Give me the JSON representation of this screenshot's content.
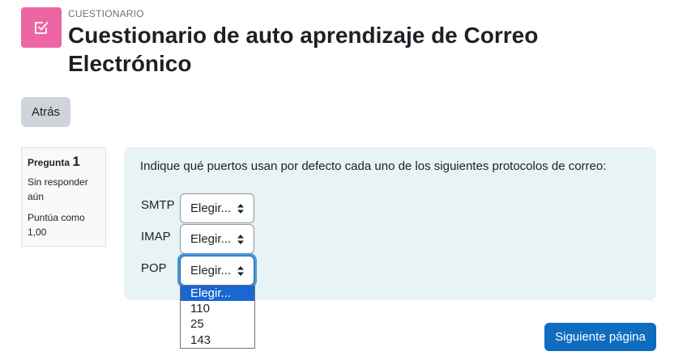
{
  "header": {
    "activity_icon": "quiz-checkbox-icon",
    "activity_type": "CUESTIONARIO",
    "title": "Cuestionario de auto aprendizaje de Correo Electrónico"
  },
  "nav": {
    "back_label": "Atrás"
  },
  "question_info": {
    "label": "Pregunta",
    "number": "1",
    "state": "Sin responder aún",
    "grade": "Puntúa como 1,00"
  },
  "question": {
    "text": "Indique qué puertos usan por defecto cada uno de los siguientes protocolos de correo:",
    "rows": [
      {
        "label": "SMTP",
        "selected": "Elegir..."
      },
      {
        "label": "IMAP",
        "selected": "Elegir..."
      },
      {
        "label": "POP",
        "selected": "Elegir..."
      }
    ],
    "open_dropdown_options": [
      "Elegir...",
      "110",
      "25",
      "143"
    ],
    "open_dropdown_highlighted": "Elegir..."
  },
  "footer": {
    "next_label": "Siguiente página"
  },
  "colors": {
    "activity_icon_bg": "#eb66a2",
    "primary": "#0f6cbf",
    "secondary_button": "#ced4da",
    "formulation_bg": "#e7f3f5",
    "dropdown_highlight": "#1967d2"
  }
}
